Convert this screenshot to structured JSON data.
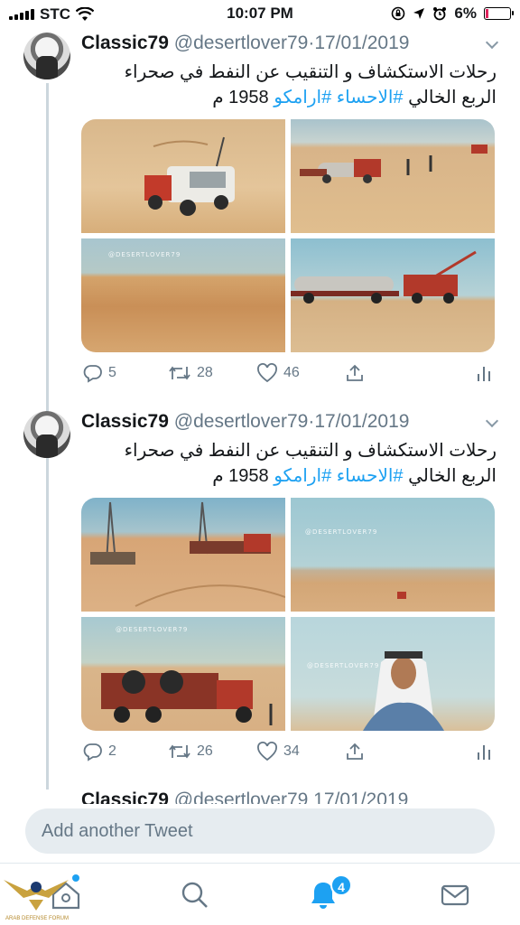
{
  "status_bar": {
    "carrier": "STC",
    "time": "10:07 PM",
    "battery": "6%",
    "icons": [
      "signal-icon",
      "wifi-icon",
      "orientation-lock-icon",
      "location-icon",
      "alarm-icon",
      "battery-icon"
    ]
  },
  "tweets": [
    {
      "name": "Classic79",
      "handle": "@desertlover79",
      "sep": "·",
      "date": "17/01/2019",
      "text_line1": "رحلات الاستكشاف و التنقيب عن النفط في صحراء",
      "text_line2_prefix": "الربع الخالي ",
      "text_tags": "#الاحساء #ارامكو",
      "text_line2_suffix": " 1958 م",
      "watermark": "@DESERTLOVER79",
      "replies": "5",
      "retweets": "28",
      "likes": "46"
    },
    {
      "name": "Classic79",
      "handle": "@desertlover79",
      "sep": "·",
      "date": "17/01/2019",
      "text_line1": "رحلات الاستكشاف و التنقيب عن النفط في صحراء",
      "text_line2_prefix": "الربع الخالي ",
      "text_tags": "#الاحساء #ارامكو",
      "text_line2_suffix": " 1958 م",
      "watermark": "@DESERTLOVER79",
      "replies": "2",
      "retweets": "26",
      "likes": "34"
    }
  ],
  "peek_tweet": {
    "name": "Classic79",
    "handle": "@desertlover79",
    "date": "17/01/2019"
  },
  "compose": {
    "placeholder": "Add another Tweet"
  },
  "tab_bar": {
    "notifications_badge": "4",
    "tabs": [
      "home-icon",
      "search-icon",
      "notifications-icon",
      "messages-icon"
    ]
  },
  "logo": {
    "text": "ARAB DEFENSE FORUM"
  },
  "colors": {
    "accent": "#1da1f2",
    "muted": "#657786",
    "thread": "#ccd6dd"
  }
}
